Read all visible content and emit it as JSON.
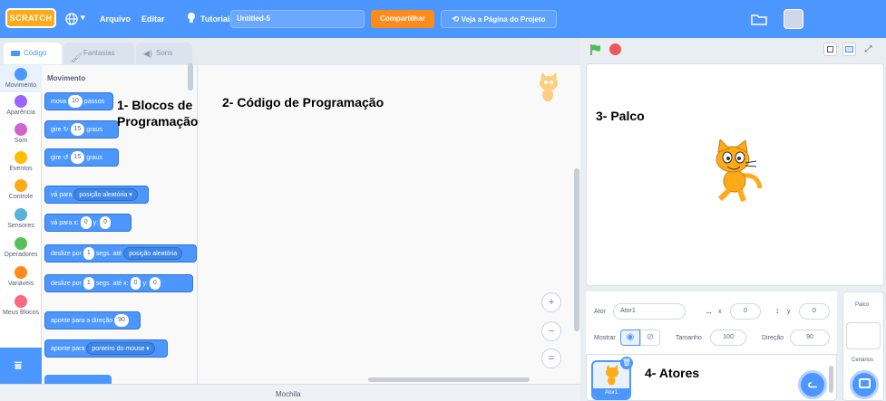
{
  "menubar": {
    "logo": "SCRATCH",
    "language_caret": "▾",
    "file": "Arquivo",
    "edit": "Editar",
    "tutorials": "Tutoriais",
    "project_title": "Untitled-5",
    "share": "Compartilhar",
    "see_project": "Veja a Página do Projeto"
  },
  "tabs": {
    "code": "Código",
    "costumes": "Fantasias",
    "sounds": "Sons"
  },
  "categories": {
    "motion": {
      "label": "Movimento",
      "color": "#4c97ff"
    },
    "looks": {
      "label": "Aparência",
      "color": "#9966ff"
    },
    "sound": {
      "label": "Som",
      "color": "#cf63cf"
    },
    "events": {
      "label": "Eventos",
      "color": "#ffbf00"
    },
    "control": {
      "label": "Controle",
      "color": "#ffab19"
    },
    "sensing": {
      "label": "Sensores",
      "color": "#5cb1d6"
    },
    "operators": {
      "label": "Operadores",
      "color": "#59c059"
    },
    "variables": {
      "label": "Variáveis",
      "color": "#ff8c1a"
    },
    "myblocks": {
      "label": "Meus Blocos",
      "color": "#ff6680"
    }
  },
  "palette": {
    "heading": "Movimento",
    "move": {
      "a": "mova",
      "v": "10",
      "b": "passos"
    },
    "turn_right": {
      "a": "gire",
      "v": "15",
      "b": "graus"
    },
    "turn_left": {
      "a": "gire",
      "v": "15",
      "b": "graus"
    },
    "goto": {
      "a": "vá para",
      "drop": "posição aleatória"
    },
    "goto_xy": {
      "a": "vá para x:",
      "x": "0",
      "b": "y:",
      "y": "0"
    },
    "glide": {
      "a": "deslize por",
      "v": "1",
      "b": "segs. até",
      "drop": "posição aleatória"
    },
    "glide_xy": {
      "a": "deslize por",
      "v": "1",
      "b": "segs. até x:",
      "x": "0",
      "c": "y:",
      "y": "0"
    },
    "point_dir": {
      "a": "aponte para a direção",
      "v": "90"
    },
    "point_to": {
      "a": "aponte para",
      "drop": "ponteiro do mouse"
    }
  },
  "annotations": {
    "blocks1": "1- Blocos de",
    "blocks2": "Programação",
    "code": "2- Código de Programação",
    "stage": "3- Palco",
    "sprites": "4- Atores"
  },
  "zoom": {
    "in": "+",
    "out": "−",
    "reset": "="
  },
  "backpack": "Mochila",
  "sprite_info": {
    "actor_label": "Ator",
    "actor_name": "Ator1",
    "x_label": "x",
    "x": "0",
    "y_label": "y",
    "y": "0",
    "show_label": "Mostrar",
    "size_label": "Tamanho",
    "size": "100",
    "direction_label": "Direção",
    "direction": "90"
  },
  "sprite_tile": {
    "name": "Ator1"
  },
  "stage_panel": {
    "label": "Palco",
    "backdrops": "Cenários"
  }
}
